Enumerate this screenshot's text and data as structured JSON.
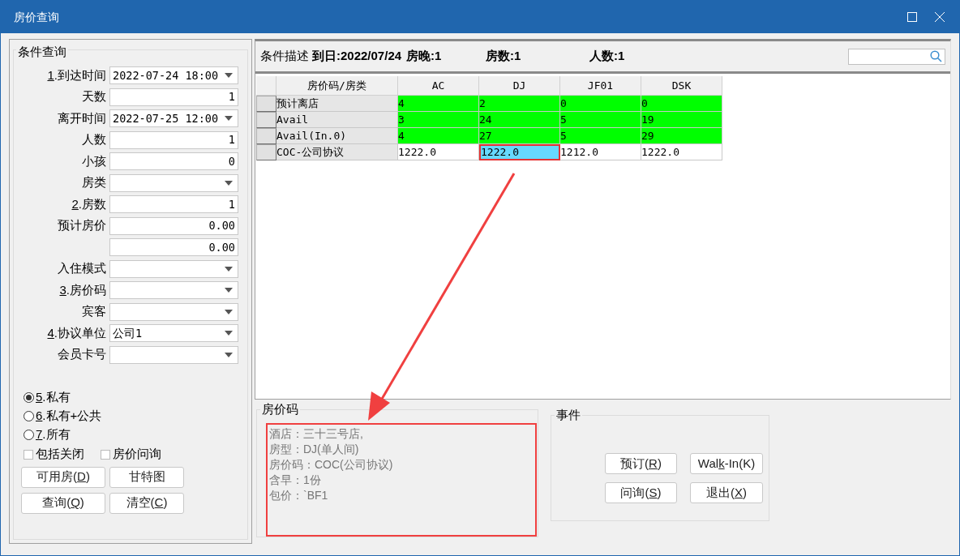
{
  "window": {
    "title": "房价查询"
  },
  "conditions": {
    "title": "条件查询",
    "fields": [
      {
        "label": {
          "key": "1",
          "post": ".到达时间"
        },
        "kind": "combo",
        "value": "2022-07-24 18:00"
      },
      {
        "label": {
          "post": "天数"
        },
        "kind": "number",
        "value": "1"
      },
      {
        "label": {
          "post": "离开时间"
        },
        "kind": "combo",
        "value": "2022-07-25 12:00"
      },
      {
        "label": {
          "post": "人数"
        },
        "kind": "number",
        "value": "1"
      },
      {
        "label": {
          "post": "小孩"
        },
        "kind": "number",
        "value": "0"
      },
      {
        "label": {
          "post": "房类"
        },
        "kind": "combo"
      },
      {
        "label": {
          "key": "2",
          "post": ".房数"
        },
        "kind": "number",
        "value": "1"
      },
      {
        "label": {
          "post": "预计房价"
        },
        "kind": "number",
        "value": "0.00"
      },
      {
        "kind": "number",
        "value": "0.00"
      },
      {
        "label": {
          "post": "入住模式"
        },
        "kind": "combo"
      },
      {
        "label": {
          "key": "3",
          "post": ".房价码"
        },
        "kind": "combo"
      },
      {
        "label": {
          "post": "宾客"
        },
        "kind": "combo"
      },
      {
        "label": {
          "key": "4",
          "post": ".协议单位"
        },
        "kind": "combo",
        "value": "公司1"
      },
      {
        "label": {
          "post": "会员卡号"
        },
        "kind": "combo"
      }
    ],
    "radios": [
      {
        "label": {
          "key": "5",
          "post": ".私有"
        },
        "selected": true
      },
      {
        "label": {
          "key": "6",
          "post": ".私有+公共"
        },
        "selected": false
      },
      {
        "label": {
          "key": "7",
          "post": ".所有"
        },
        "selected": false
      }
    ],
    "checkboxes": [
      {
        "label": "包括关闭",
        "checked": false
      },
      {
        "label": "房价问询",
        "checked": false
      }
    ],
    "buttons": [
      {
        "label": {
          "pre": "可用房(",
          "key": "D",
          "post": ")"
        }
      },
      {
        "label": {
          "post": "甘特图"
        }
      },
      {
        "label": {
          "pre": "查询(",
          "key": "Q",
          "post": ")"
        }
      },
      {
        "label": {
          "pre": "清空(",
          "key": "C",
          "post": ")"
        }
      }
    ]
  },
  "summary": {
    "label": "条件描述",
    "arrival": "到日:2022/07/24",
    "nights": "房晚:1",
    "rooms": "房数:1",
    "people": "人数:1"
  },
  "table": {
    "columns": [
      "房价码/房类",
      "AC",
      "DJ",
      "JF01",
      "DSK"
    ],
    "rows": [
      {
        "kind": "availability",
        "name": "预计离店",
        "cells": [
          {
            "text": "4",
            "selected": false
          },
          {
            "text": "2",
            "selected": false
          },
          {
            "text": "0",
            "selected": false
          },
          {
            "text": "0",
            "selected": false
          }
        ]
      },
      {
        "kind": "availability",
        "name": "Avail",
        "cells": [
          {
            "text": "3",
            "selected": false
          },
          {
            "text": "24",
            "selected": false
          },
          {
            "text": "5",
            "selected": false
          },
          {
            "text": "19",
            "selected": false
          }
        ]
      },
      {
        "kind": "availability",
        "name": "Avail(In.0)",
        "cells": [
          {
            "text": "4",
            "selected": false
          },
          {
            "text": "27",
            "selected": false
          },
          {
            "text": "5",
            "selected": false
          },
          {
            "text": "29",
            "selected": false
          }
        ]
      },
      {
        "kind": "rate",
        "name": "COC-公司协议",
        "cells": [
          {
            "text": "1222.0",
            "selected": false
          },
          {
            "text": "1222.0",
            "selected": true
          },
          {
            "text": "1212.0",
            "selected": false
          },
          {
            "text": "1222.0",
            "selected": false
          }
        ]
      }
    ]
  },
  "rate_code": {
    "title": "房价码",
    "lines": [
      "酒店：三十三号店,",
      "房型：DJ(单人间)",
      "房价码：COC(公司协议)",
      "含早：1份",
      "包价：`BF1"
    ]
  },
  "events": {
    "title": "事件",
    "buttons": [
      {
        "label": {
          "pre": "预订(",
          "key": "R",
          "post": ")"
        }
      },
      {
        "label": {
          "pre": "Wal",
          "key": "k",
          "post": "-In(K)"
        }
      },
      {
        "label": {
          "pre": "问询(",
          "key": "S",
          "post": ")"
        }
      },
      {
        "label": {
          "pre": "退出(",
          "key": "X",
          "post": ")"
        }
      }
    ]
  }
}
